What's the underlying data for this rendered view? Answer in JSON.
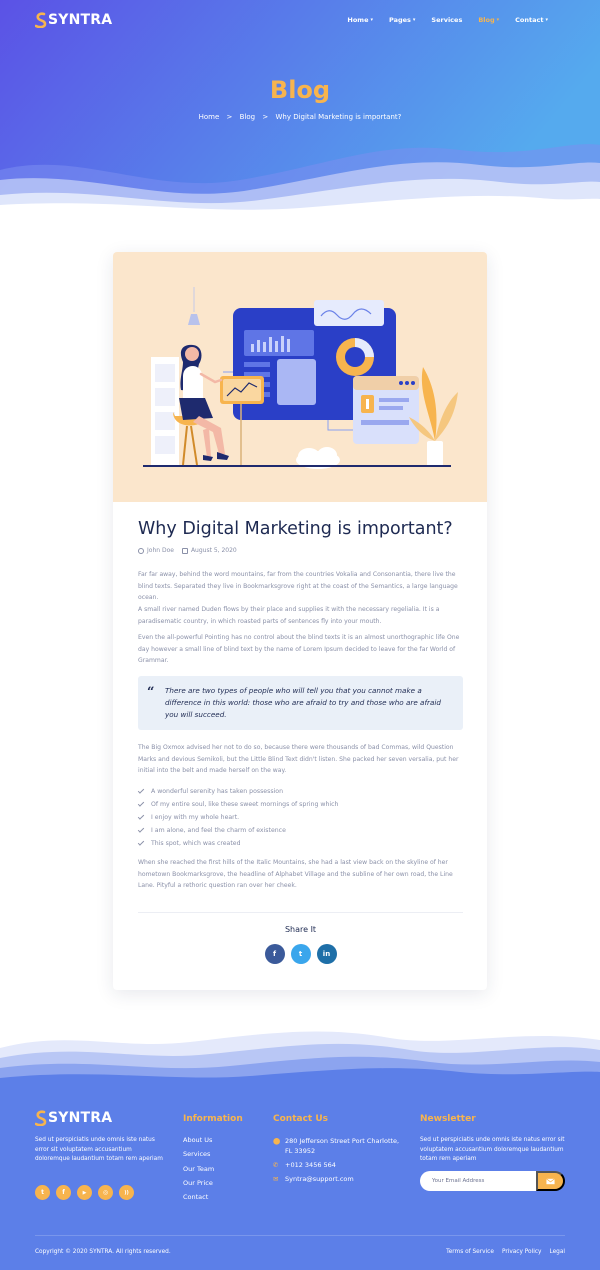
{
  "brand": {
    "name": "SYNTRA"
  },
  "nav": {
    "items": [
      {
        "label": "Home",
        "dropdown": true
      },
      {
        "label": "Pages",
        "dropdown": true
      },
      {
        "label": "Services",
        "dropdown": false
      },
      {
        "label": "Blog",
        "dropdown": true,
        "active": true
      },
      {
        "label": "Contact",
        "dropdown": true
      }
    ]
  },
  "hero": {
    "title": "Blog",
    "breadcrumb": [
      "Home",
      "Blog",
      "Why Digital Marketing is important?"
    ],
    "separator": ">"
  },
  "post": {
    "title": "Why Digital Marketing is important?",
    "author": "John Doe",
    "date": "August 5, 2020",
    "paragraphs": [
      "Far far away, behind the word mountains, far from the countries Vokalia and Consonantia, there live the blind texts. Separated they live in Bookmarksgrove right at the coast of the Semantics, a large language ocean.",
      "A small river named Duden flows by their place and supplies it with the necessary regelialia. It is a paradisematic country, in which roasted parts of sentences fly into your mouth.",
      "Even the all-powerful Pointing has no control about the blind texts it is an almost unorthographic life One day however a small line of blind text by the name of Lorem Ipsum decided to leave for the far World of Grammar."
    ],
    "quote": "There are two types of people who will tell you that you cannot make a difference in this world: those who are afraid to try and those who are afraid you will succeed.",
    "paragraph_after_quote": "The Big Oxmox advised her not to do so, because there were thousands of bad Commas, wild Question Marks and devious Semikoli, but the Little Blind Text didn't listen. She packed her seven versalia, put her initial into the belt and made herself on the way.",
    "checklist": [
      "A wonderful serenity has taken possession",
      "Of my entire soul, like these sweet mornings of spring which",
      "I enjoy with my whole heart.",
      "I am alone, and feel the charm of existence",
      "This spot, which was created"
    ],
    "closing_paragraph": "When she reached the first hills of the Italic Mountains, she had a last view back on the skyline of her hometown Bookmarksgrove, the headline of Alphabet Village and the subline of her own road, the Line Lane. Pityful a rethoric question ran over her cheek.",
    "share": {
      "title": "Share It",
      "buttons": [
        {
          "icon": "facebook-icon",
          "glyph": "f"
        },
        {
          "icon": "twitter-icon",
          "glyph": "t"
        },
        {
          "icon": "linkedin-icon",
          "glyph": "in"
        }
      ]
    }
  },
  "footer": {
    "about": "Sed ut perspiciatis unde omnis iste natus error sit voluptatem accusantium doloremque laudantium totam rem aperiam",
    "socials": [
      {
        "icon": "twitter-icon",
        "glyph": "t"
      },
      {
        "icon": "facebook-icon",
        "glyph": "f"
      },
      {
        "icon": "youtube-icon",
        "glyph": "▶"
      },
      {
        "icon": "instagram-icon",
        "glyph": "◎"
      },
      {
        "icon": "rss-icon",
        "glyph": "))"
      }
    ],
    "information": {
      "heading": "Information",
      "links": [
        "About Us",
        "Services",
        "Our Team",
        "Our Price",
        "Contact"
      ]
    },
    "contact": {
      "heading": "Contact Us",
      "address": "280 Jefferson Street Port Charlotte, FL 33952",
      "phone": "+012 3456 564",
      "email": "Syntra@support.com"
    },
    "newsletter": {
      "heading": "Newsletter",
      "text": "Sed ut perspiciatis unde omnis iste natus error sit voluptatem accusantium doloremque laudantium totam rem aperiam",
      "placeholder": "Your Email Address"
    },
    "copyright": "Copyright © 2020 SYNTRA. All rights reserved.",
    "legal": [
      "Terms of Service",
      "Privacy Policy",
      "Legal"
    ]
  },
  "colors": {
    "accent": "#f7b44e",
    "navy": "#1e2a52",
    "hero_from": "#5b5de8",
    "hero_to": "#5aa9ec",
    "footer_bg": "#5c7fe8",
    "muted_text": "#8a90a8"
  }
}
